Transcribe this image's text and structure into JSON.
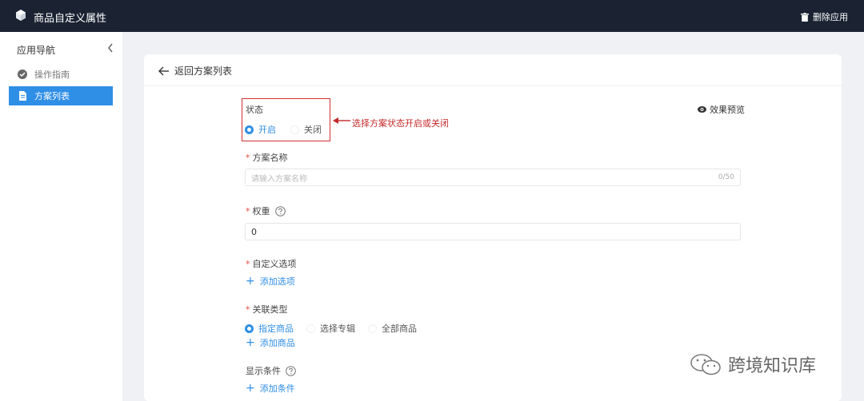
{
  "topbar": {
    "title": "商品自定义属性",
    "delete_label": "删除应用"
  },
  "sidebar": {
    "title": "应用导航",
    "items": [
      {
        "label": "操作指南",
        "icon": "check-circle-icon"
      },
      {
        "label": "方案列表",
        "icon": "document-icon"
      }
    ]
  },
  "card": {
    "back_label": "返回方案列表",
    "preview_label": "效果预览",
    "status": {
      "label": "状态",
      "options": [
        "开启",
        "关闭"
      ],
      "selected": "开启"
    },
    "annotation": "选择方案状态开启或关闭",
    "name_field": {
      "label": "方案名称",
      "placeholder": "请输入方案名称",
      "counter": "0/50"
    },
    "weight_field": {
      "label": "权重",
      "value": "0"
    },
    "custom_options": {
      "label": "自定义选项",
      "add_label": "添加选项"
    },
    "relation_type": {
      "label": "关联类型",
      "options": [
        "指定商品",
        "选择专辑",
        "全部商品"
      ],
      "selected": "指定商品",
      "add_label": "添加商品"
    },
    "display_condition": {
      "label": "显示条件",
      "add_label": "添加条件"
    }
  },
  "watermark": "跨境知识库",
  "colors": {
    "topbar": "#1b2333",
    "accent": "#2f8ee6",
    "annotation": "#c62828"
  }
}
